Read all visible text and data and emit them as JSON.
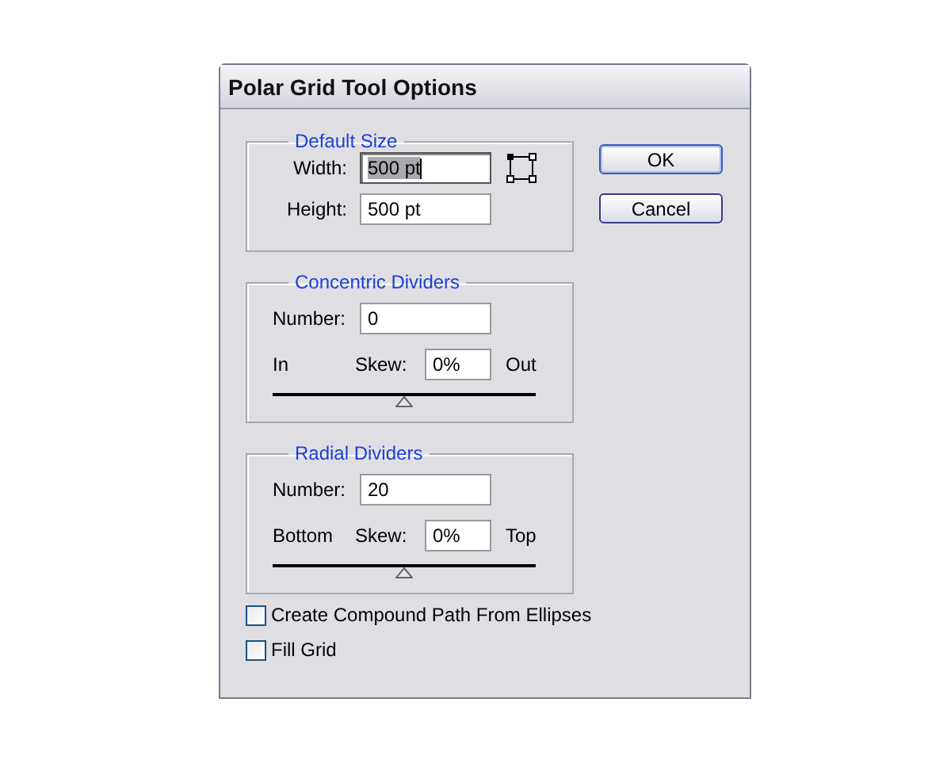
{
  "window": {
    "title": "Polar Grid Tool Options"
  },
  "default_size": {
    "title": "Default Size",
    "fields": [
      {
        "label": "Width:",
        "value": "500 pt",
        "highlighted": true
      },
      {
        "label": "Height:",
        "value": "500 pt",
        "highlighted": false
      }
    ]
  },
  "divider_groups": [
    {
      "title": "Concentric Dividers",
      "number_label": "Number:",
      "number": "0",
      "left_label": "In",
      "skew_label": "Skew:",
      "skew": "0%",
      "right_label": "Out",
      "level": 0.5
    },
    {
      "title": "Radial Dividers",
      "number_label": "Number:",
      "number": "20",
      "left_label": "Bottom",
      "skew_label": "Skew:",
      "skew": "0%",
      "right_label": "Top",
      "level": 0.5
    }
  ],
  "checkboxes": [
    {
      "label": "Create Compound Path From Ellipses",
      "checked": false
    },
    {
      "label": "Fill Grid",
      "checked": false
    }
  ],
  "buttons": [
    {
      "label": "OK",
      "default": true
    },
    {
      "label": "Cancel",
      "default": false
    }
  ]
}
